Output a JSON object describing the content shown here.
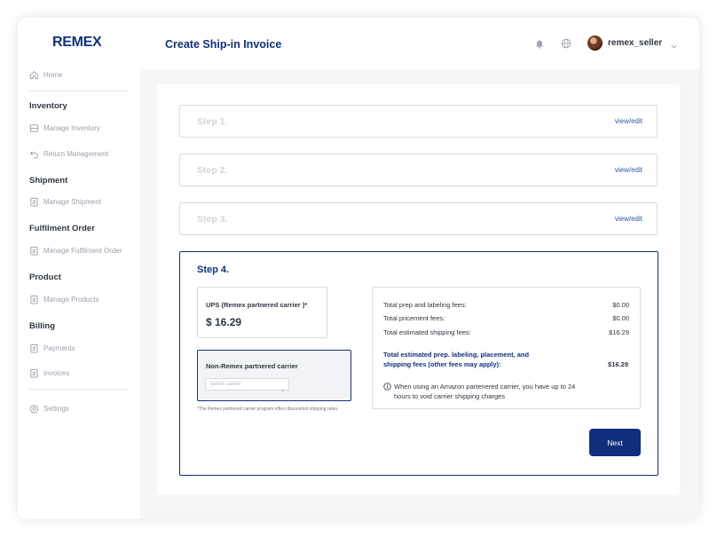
{
  "app": {
    "logo": "REMEX"
  },
  "header": {
    "title": "Create Ship-in Invoice",
    "username": "remex_seller"
  },
  "sidebar": {
    "home": "Home",
    "groups": {
      "inventory": "Inventory",
      "shipment": "Shipment",
      "fulfilment": "Fulfilment Order",
      "product": "Product",
      "billing": "Billing"
    },
    "items": {
      "manage_inventory": "Manage Inventory",
      "return_management": "Return Management",
      "manage_shipment": "Manage Shipment",
      "manage_fulfilment": "Manage Fulfilment Order",
      "manage_products": "Manage Products",
      "payments": "Payments",
      "invoices": "Invoices",
      "settings": "Settings"
    },
    "icons": [
      "home-icon",
      "box-icon",
      "return-icon",
      "document-icon",
      "settings-icon"
    ]
  },
  "steps": [
    {
      "label": "Step 1.",
      "action": "view/edit"
    },
    {
      "label": "Step 2.",
      "action": "view/edit"
    },
    {
      "label": "Step 3.",
      "action": "view/edit"
    }
  ],
  "step4": {
    "title": "Step 4.",
    "ups": {
      "label": "UPS (Remex partnered carrier )*",
      "price": "$ 16.29"
    },
    "non_remex": {
      "label": "Non-Remex partnered carrier",
      "select_placeholder": "Select carrier"
    },
    "footnote": "*The Remex partnered carrier program offers discounted shipping rates.",
    "fees": [
      {
        "label": "Total prep and labeling fees:",
        "amount": "$0.00"
      },
      {
        "label": "Total pricement fees:",
        "amount": "$0.00"
      },
      {
        "label": "Total estimated shipping fees:",
        "amount": "$16.29"
      }
    ],
    "total": {
      "label": "Total estimated prep. labeling, placement, and shipping fees (other fees may apply):",
      "amount": "$16.29"
    },
    "note": "When using an Amazon partenered carrier, you have up to 24 hours to void carrier shipping charges",
    "next": "Next"
  },
  "colors": {
    "brand": "#10317c",
    "muted": "#9aa1ab",
    "link": "#2f58a8"
  }
}
